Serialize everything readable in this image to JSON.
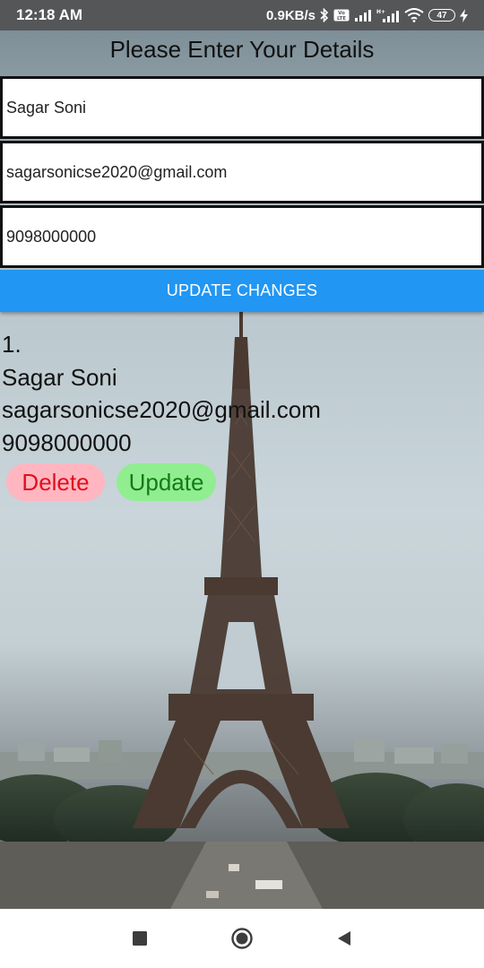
{
  "status_bar": {
    "time": "12:18 AM",
    "network_speed": "0.9KB/s",
    "battery_level": "47",
    "icons": [
      "bluetooth-icon",
      "volte-icon",
      "signal-icon",
      "signal-hplus-icon",
      "wifi-icon",
      "battery-icon",
      "charging-icon"
    ]
  },
  "header": {
    "title": "Please Enter Your Details"
  },
  "form": {
    "name_value": "Sagar Soni",
    "email_value": "sagarsonicse2020@gmail.com",
    "phone_value": "9098000000",
    "submit_label": "UPDATE CHANGES"
  },
  "records": [
    {
      "index": "1.",
      "name": "Sagar Soni",
      "email": "sagarsonicse2020@gmail.com",
      "phone": "9098000000",
      "delete_label": "Delete",
      "update_label": "Update"
    }
  ],
  "colors": {
    "button_primary": "#2196f3",
    "delete_bg": "#ffb6c1",
    "delete_text": "#e0101c",
    "update_bg": "#90ee90",
    "update_text": "#157a15"
  },
  "nav_bar": {
    "icons": [
      "recents-square-icon",
      "home-circle-icon",
      "back-triangle-icon"
    ]
  }
}
